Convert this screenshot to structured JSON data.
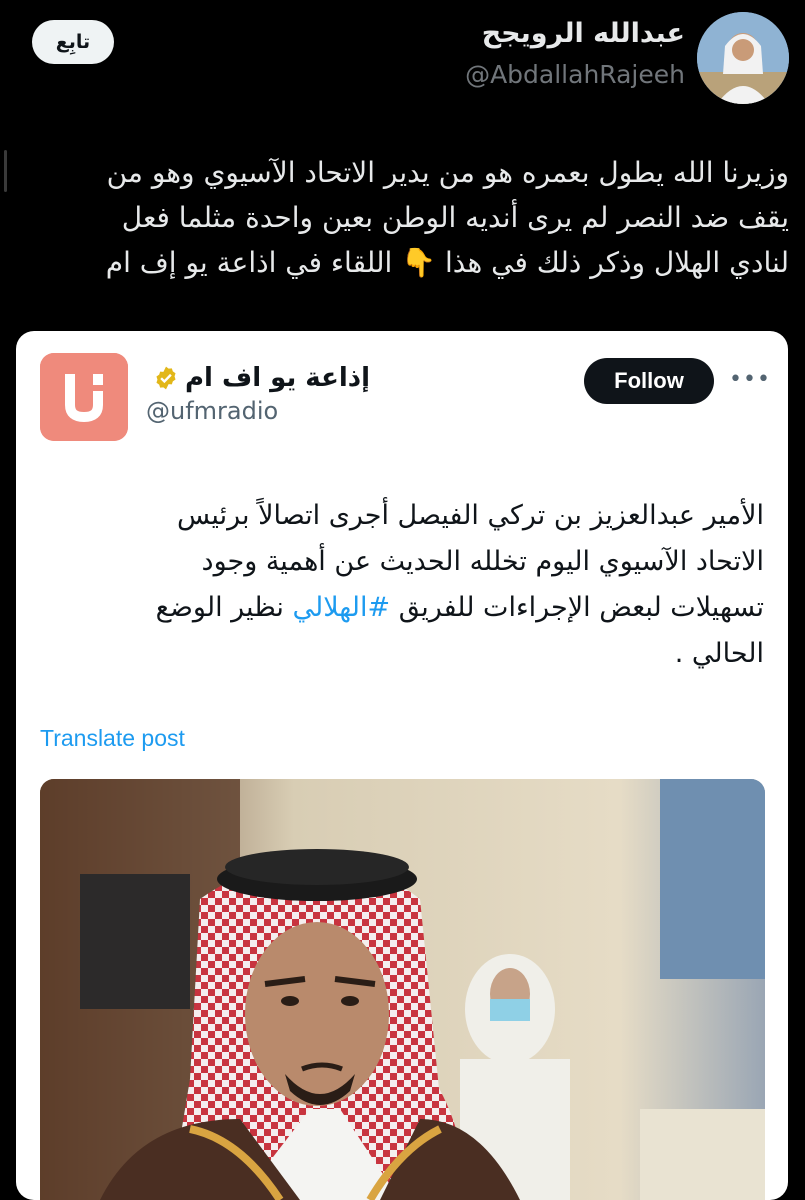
{
  "outer_tweet": {
    "author_name": "عبدالله الرويجح",
    "author_handle": "@AbdallahRajeeh",
    "follow_label": "تابِع",
    "text_lines": [
      "وزيرنا الله يطول بعمره هو من يدير الاتحاد الآسيوي وهو من",
      "يقف ضد النصر لم يرى أنديه الوطن بعين واحدة مثلما فعل",
      "لنادي الهلال وذكر ذلك في هذا 👇 اللقاء في اذاعة يو إف ام"
    ]
  },
  "quoted_tweet": {
    "author_name": "إذاعة يو اف ام",
    "author_handle": "@ufmradio",
    "verified_icon": "verified-badge-icon",
    "follow_label": "Follow",
    "more_icon": "more-options-icon",
    "text_lines": [
      "الأمير عبدالعزيز بن تركي الفيصل أجرى اتصالاً برئيس",
      "الاتحاد الآسيوي اليوم تخلله الحديث عن أهمية وجود"
    ],
    "line3_before_hashtag": "تسهيلات لبعض الإجراءات للفريق ",
    "hashtag": "#الهلالي",
    "line3_after_hashtag": " نظير الوضع",
    "line4": "الحالي .",
    "translate_label": "Translate post"
  },
  "colors": {
    "background": "#000000",
    "link": "#1d9bf0",
    "card_bg": "#ffffff",
    "brand_logo": "#ef8a7c",
    "verified_gold": "#e2b719"
  }
}
